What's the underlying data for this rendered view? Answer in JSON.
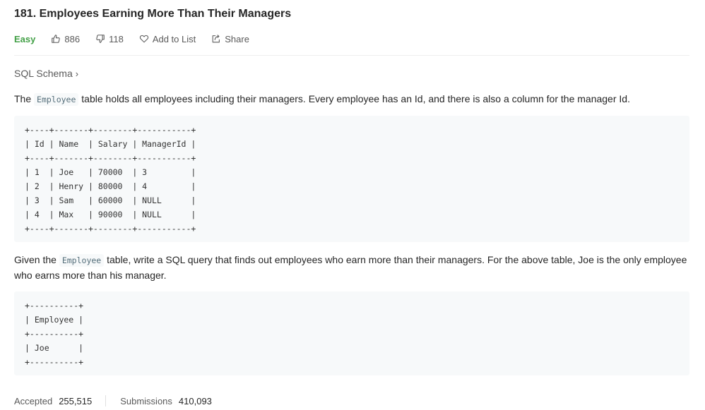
{
  "problem": {
    "title": "181. Employees Earning More Than Their Managers",
    "difficulty": "Easy",
    "likes": "886",
    "dislikes": "118",
    "add_to_list": "Add to List",
    "share": "Share"
  },
  "schema_link": "SQL Schema",
  "description": {
    "p1_before": "The ",
    "p1_code": "Employee",
    "p1_after": " table holds all employees including their managers. Every employee has an Id, and there is also a column for the manager Id.",
    "table1": "+----+-------+--------+-----------+\n| Id | Name  | Salary | ManagerId |\n+----+-------+--------+-----------+\n| 1  | Joe   | 70000  | 3         |\n| 2  | Henry | 80000  | 4         |\n| 3  | Sam   | 60000  | NULL      |\n| 4  | Max   | 90000  | NULL      |\n+----+-------+--------+-----------+",
    "p2_before": "Given the ",
    "p2_code": "Employee",
    "p2_after": " table, write a SQL query that finds out employees who earn more than their managers. For the above table, Joe is the only employee who earns more than his manager.",
    "table2": "+----------+\n| Employee |\n+----------+\n| Joe      |\n+----------+"
  },
  "stats": {
    "accepted_label": "Accepted",
    "accepted_value": "255,515",
    "submissions_label": "Submissions",
    "submissions_value": "410,093"
  },
  "colors": {
    "easy": "#43a047",
    "code_bg": "#f7f9fa",
    "muted_text": "#595959"
  }
}
